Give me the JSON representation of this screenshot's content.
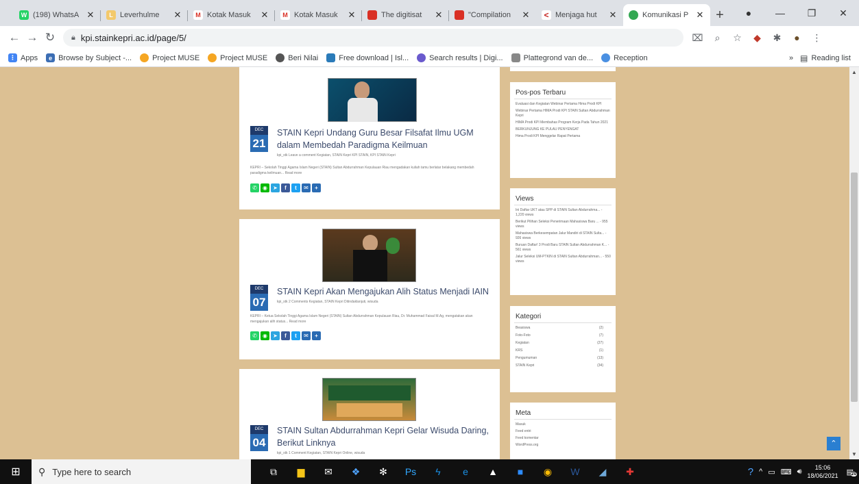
{
  "tabs": [
    {
      "title": "(198) WhatsA",
      "color": "#25d366",
      "glyph": "W"
    },
    {
      "title": "Leverhulme",
      "color": "#f3c96b",
      "glyph": "L"
    },
    {
      "title": "Kotak Masuk",
      "color": "#ffffff",
      "glyph": "M"
    },
    {
      "title": "Kotak Masuk",
      "color": "#ffffff",
      "glyph": "M"
    },
    {
      "title": "The digitisat",
      "color": "#d93025",
      "glyph": "▮"
    },
    {
      "title": "\"Compilation",
      "color": "#d93025",
      "glyph": "▮"
    },
    {
      "title": "Menjaga hut",
      "color": "#c5221f",
      "glyph": "<"
    },
    {
      "title": "Komunikasi P",
      "color": "#34a853",
      "glyph": "●"
    }
  ],
  "address": {
    "url": "kpi.stainkepri.ac.id/page/5/"
  },
  "bookmarks": [
    {
      "label": "Apps",
      "color": "#4285f4"
    },
    {
      "label": "Browse by Subject -...",
      "color": "#3c6eb4"
    },
    {
      "label": "Project MUSE",
      "color": "#f5a623"
    },
    {
      "label": "Project MUSE",
      "color": "#f5a623"
    },
    {
      "label": "Beri Nilai",
      "color": "#555555"
    },
    {
      "label": "Free download | Isl...",
      "color": "#2b7bb9"
    },
    {
      "label": "Search results | Digi...",
      "color": "#6a5acd"
    },
    {
      "label": "Plattegrond van de...",
      "color": "#888888"
    },
    {
      "label": "Reception",
      "color": "#4a90e2"
    }
  ],
  "bookmarks_right": {
    "more": "»",
    "reading": "Reading list"
  },
  "posts": [
    {
      "month": "DEC",
      "day": "21",
      "title": "STAIN Kepri Undang Guru Besar Filsafat Ilmu UGM dalam Membedah Paradigma Keilmuan",
      "meta": "kpi_stk    Leave a comment    Kegiatan, STAIN Kepri    KPI STAIN, KPI STAIN Kepri",
      "excerpt": "KEPRI – Sekolah Tinggi Agama Islam Negeri (STAIN) Sultan Abdurrahman Kepulauan Riau mengadakan kuliah tamu berlatar belakang membedah paradigma keilmuan... Read more"
    },
    {
      "month": "DEC",
      "day": "07",
      "title": "STAIN Kepri Akan Mengajukan Alih Status Menjadi IAIN",
      "meta": "kpi_stk    2 Comments    Kegiatan, STAIN Kepri    Ditindaklanjuti, wisuda",
      "excerpt": "KEPRI – Ketua Sekolah Tinggi Agama Islam Negeri (STAIN) Sultan Abdurrahman Kepulauan Riau, Dr. Muhammad Faisal M.Ag, mengatakan akan mengajukan alih status... Read more"
    },
    {
      "month": "DEC",
      "day": "04",
      "title": "STAIN Sultan Abdurrahman Kepri Gelar Wisuda Daring, Berikut Linknya",
      "meta": "kpi_stk    1 Comment    Kegiatan, STAIN Kepri    Online, wisuda",
      "excerpt": ""
    }
  ],
  "widgets": {
    "recent": {
      "title": "Pos-pos Terbaru",
      "items": [
        "Evaluasi dan Kegiatan Webinar Pertama Hima Prodi KPI",
        "Webinar Pertama HIMA Prodi KPI STAIN Sultan Abdurrahman Kepri",
        "HIMA Prodi KPI Membahas Program Kerja Pada Tahun 2021",
        "BERKUNJUNG KE PULAU PENYENGAT",
        "Hima Prodi KPI Menggelar Rapat Pertama"
      ]
    },
    "views": {
      "title": "Views",
      "items": [
        "Ini Daftar UKT atau SPP di STAIN Sultan Abdurrahma... - 1,220 views",
        "Berikut Pilihan Seleksi Penerimaan Mahasiswa Baru ... - 955 views",
        "Mahasiswa Berkesempatan Jalur Mandiri di STAIN Sulta... - 926 views",
        "Buruan Daftar! 3 Prodi Baru STAIN Sultan Abdurrahman K... - 561 views",
        "Jalur Seleksi UM-PTKIN di STAIN Sultan Abdurrahman... - 550 views"
      ]
    },
    "categories": {
      "title": "Kategori",
      "items": [
        {
          "name": "Beasiswa",
          "count": "(2)"
        },
        {
          "name": "Foto-Foto",
          "count": "(7)"
        },
        {
          "name": "Kegiatan",
          "count": "(27)"
        },
        {
          "name": "KRS",
          "count": "(1)"
        },
        {
          "name": "Pengumuman",
          "count": "(13)"
        },
        {
          "name": "STAIN Kepri",
          "count": "(34)"
        }
      ]
    },
    "meta": {
      "title": "Meta",
      "items": [
        "Masuk",
        "Feed entri",
        "Feed komentar",
        "WordPress.org"
      ]
    }
  },
  "taskbar": {
    "search_placeholder": "Type here to search",
    "time": "15:06",
    "date": "18/06/2021",
    "notif_count": "20"
  }
}
